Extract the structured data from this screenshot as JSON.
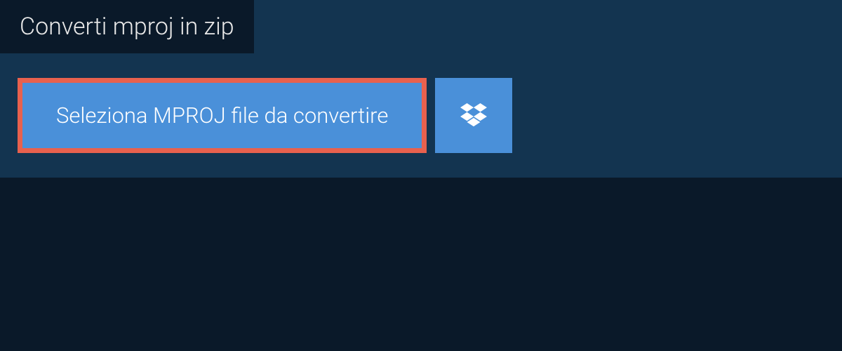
{
  "tab": {
    "title": "Converti mproj in zip"
  },
  "buttons": {
    "select_file_label": "Seleziona MPROJ file da convertire"
  }
}
